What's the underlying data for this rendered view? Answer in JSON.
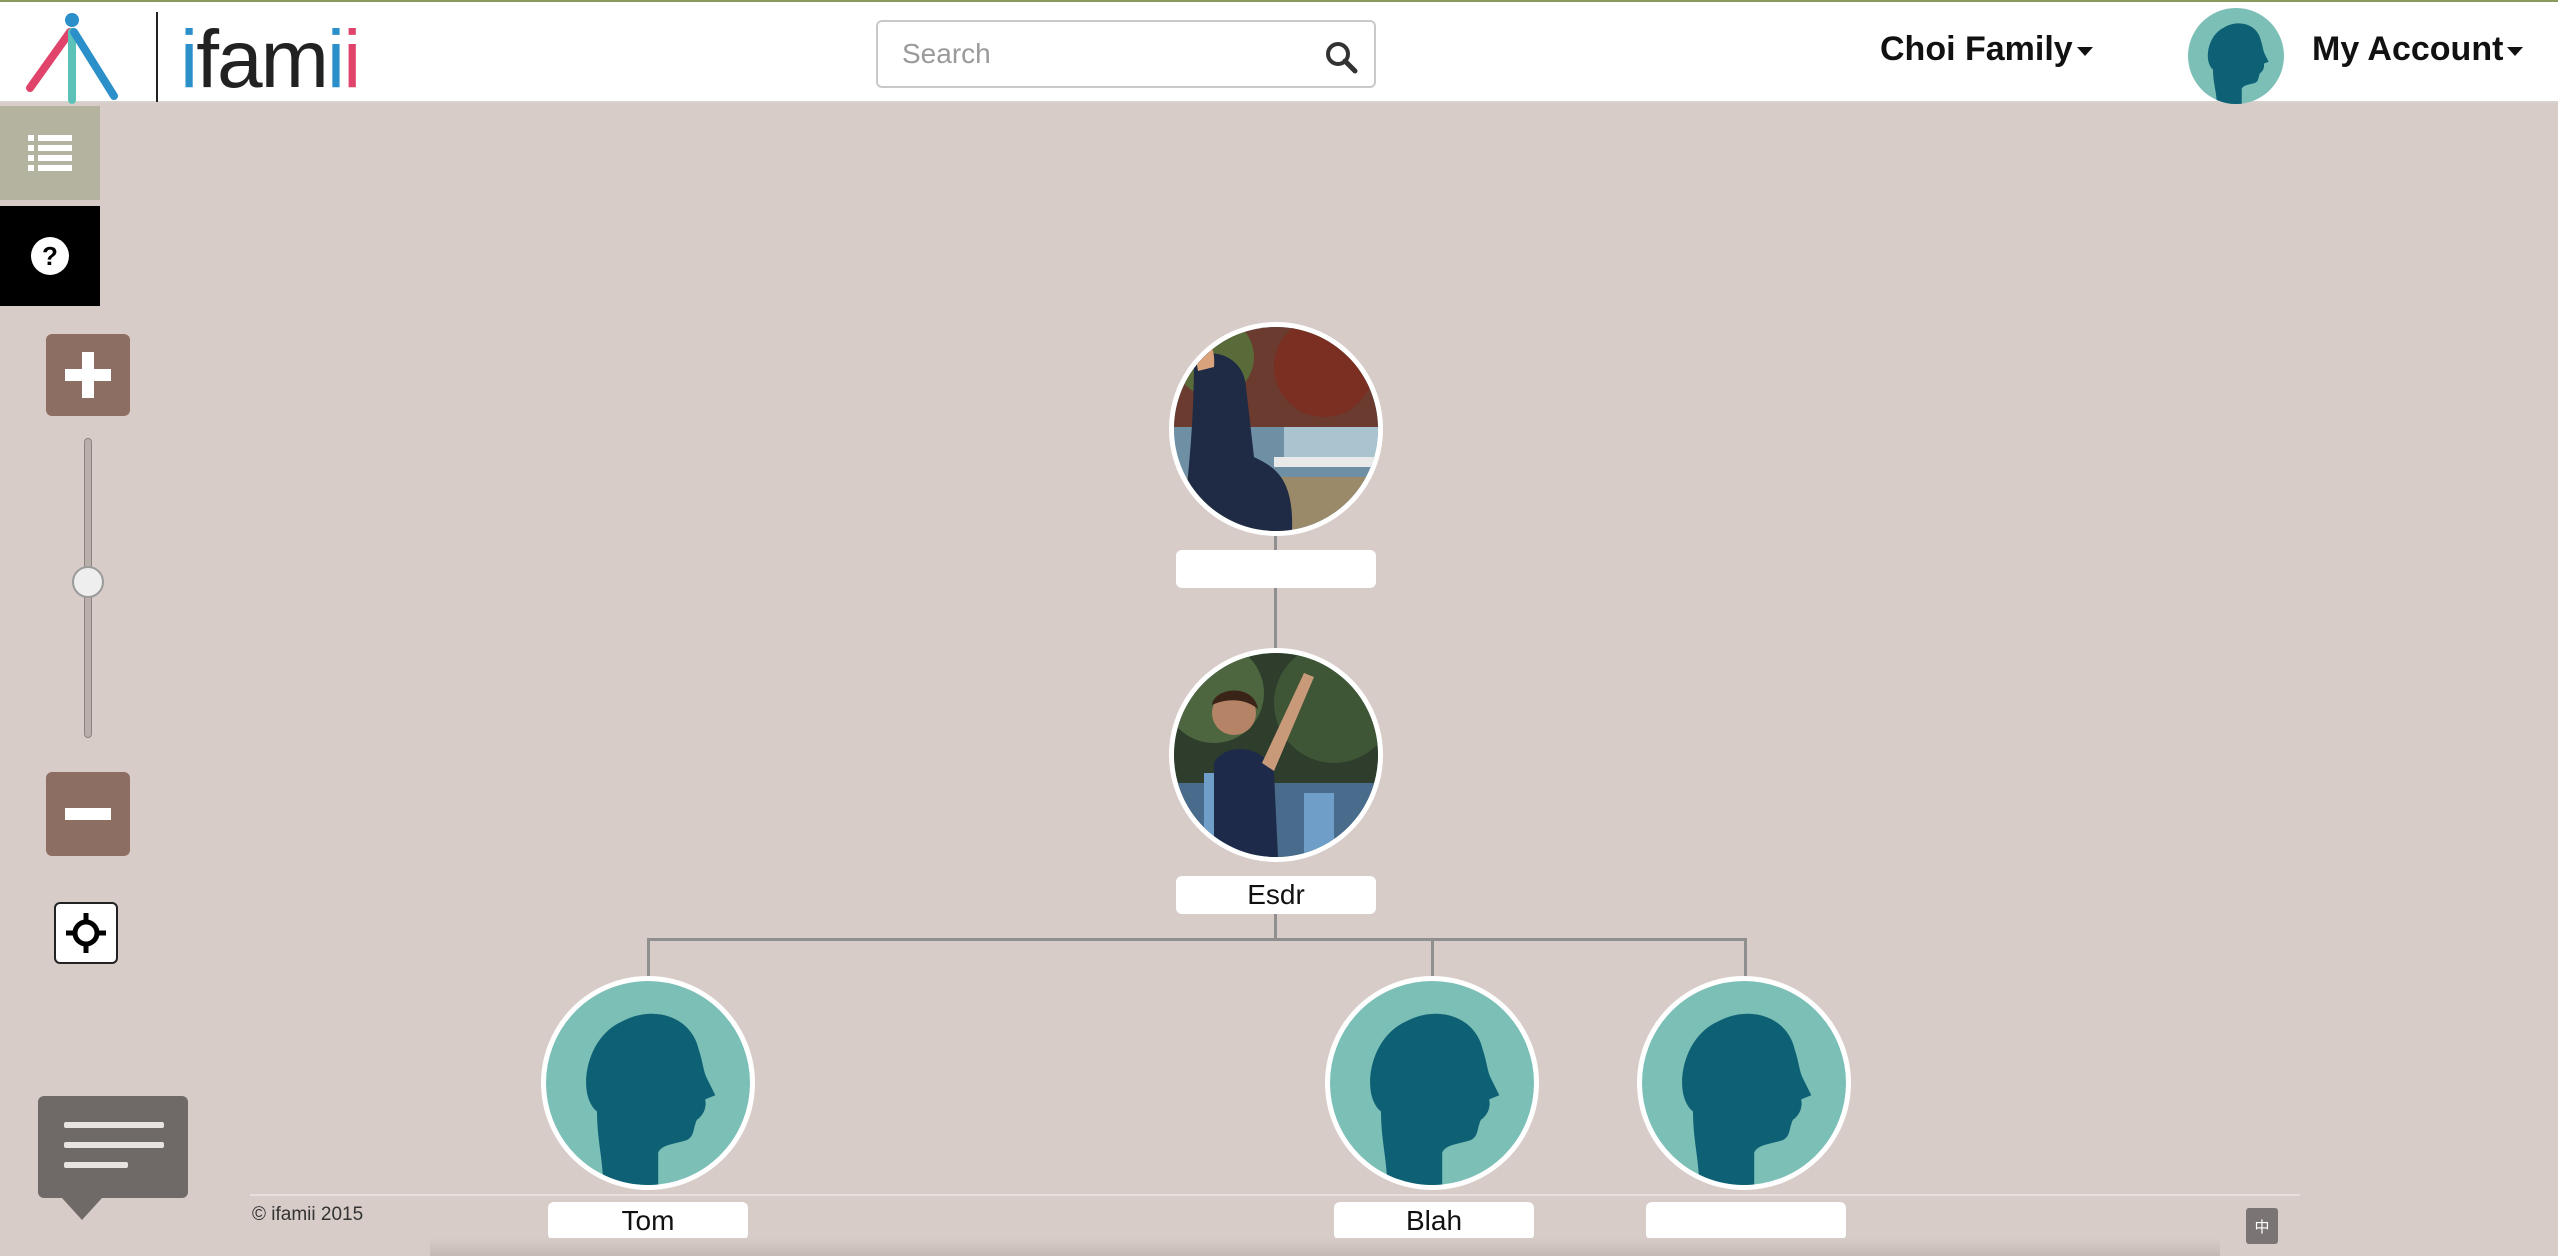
{
  "app": {
    "name": "ifamii"
  },
  "header": {
    "search_placeholder": "Search",
    "family_menu": "Choi Family",
    "account_menu": "My Account"
  },
  "toolbar": {
    "icons": [
      "list-icon",
      "question-icon",
      "plus-icon",
      "minus-icon",
      "crosshair-icon"
    ],
    "zoom_level": 0.52
  },
  "tree": {
    "nodes": [
      {
        "name": ""
      },
      {
        "name": "Esdr"
      },
      {
        "name": "Tom"
      },
      {
        "name": "Blah"
      },
      {
        "name": ""
      }
    ]
  },
  "footer": {
    "copyright": "© ifamii 2015",
    "language_button": "中"
  },
  "colors": {
    "teal": "#7bbfb7",
    "dark_teal": "#0e6175",
    "brown": "#8d6e63",
    "background": "#d7ccc8"
  }
}
